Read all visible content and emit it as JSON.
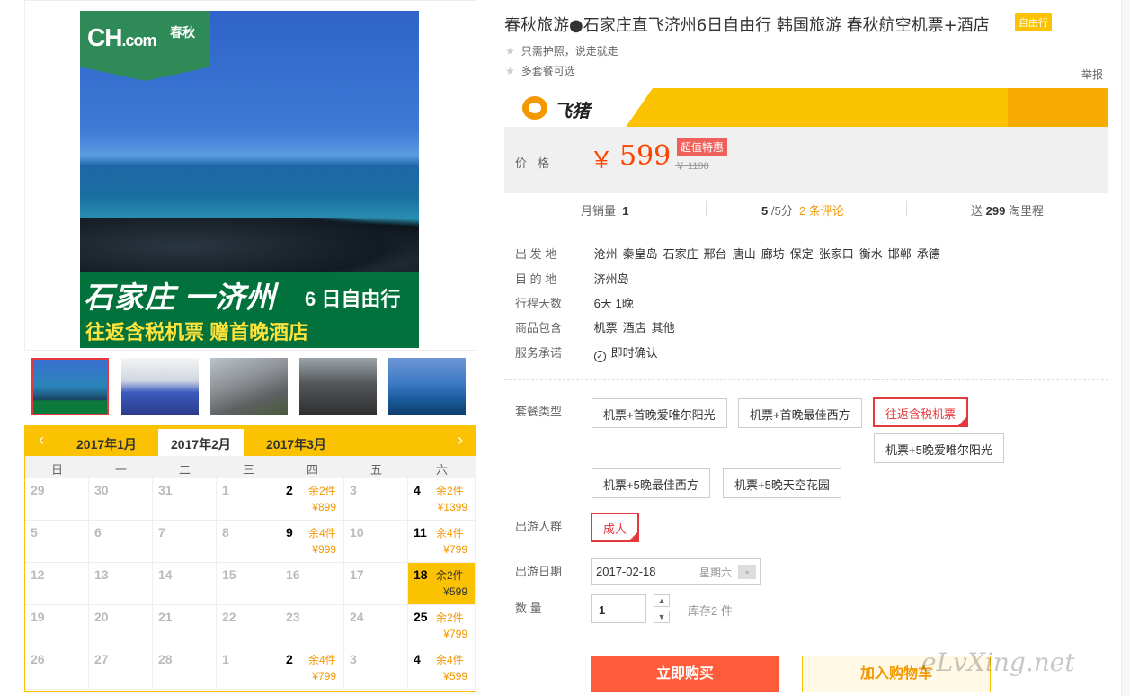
{
  "product": {
    "title": "春秋旅游●石家庄直飞济州6日自由行 韩国旅游 春秋航空机票+酒店",
    "tag": "自由行",
    "features": [
      "只需护照，说走就走",
      "多套餐可选"
    ],
    "report": "举报"
  },
  "image": {
    "logo": "CH",
    "logo_domain": ".com",
    "logo_cn": "春秋",
    "banner_title": "石家庄 一济州",
    "banner_sub1": "6 日自由行",
    "banner_sub2": "往返含税机票  赠首晚酒店"
  },
  "brand": {
    "name": "飞猪",
    "colors": {
      "accent": "#fac200",
      "price": "#ff4400"
    }
  },
  "price": {
    "label": "价格",
    "currency": "￥",
    "value": "599",
    "deal_tag": "超值特惠",
    "original": "￥ 1198"
  },
  "stats": {
    "monthly_sales_label": "月销量",
    "monthly_sales": "1",
    "rating": "5",
    "rating_suffix": "/5分",
    "reviews": "2 条评论",
    "miles_prefix": "送",
    "miles": "299",
    "miles_suffix": "淘里程"
  },
  "info": {
    "departure_label": "出 发 地",
    "departures": [
      "沧州",
      "秦皇岛",
      "石家庄",
      "邢台",
      "唐山",
      "廊坊",
      "保定",
      "张家口",
      "衡水",
      "邯郸",
      "承德"
    ],
    "destination_label": "目 的 地",
    "destination": "济州岛",
    "days_label": "行程天数",
    "days": "6天 1晚",
    "includes_label": "商品包含",
    "includes": [
      "机票",
      "酒店",
      "其他"
    ],
    "promise_label": "服务承诺",
    "promise": "即时确认"
  },
  "packages": {
    "label": "套餐类型",
    "options": [
      "机票+首晚爱唯尔阳光",
      "机票+首晚最佳西方",
      "往返含税机票",
      "机票+5晚爱唯尔阳光",
      "机票+5晚最佳西方",
      "机票+5晚天空花园"
    ],
    "selected": "往返含税机票"
  },
  "travelers": {
    "label": "出游人群",
    "option": "成人"
  },
  "date": {
    "label": "出游日期",
    "value": "2017-02-18",
    "weekday": "星期六"
  },
  "quantity": {
    "label": "数 量",
    "value": "1",
    "stock": "库存2 件"
  },
  "actions": {
    "buy": "立即购买",
    "cart": "加入购物车"
  },
  "watermark": "eLvXing.net",
  "calendar": {
    "months": [
      "2017年1月",
      "2017年2月",
      "2017年3月"
    ],
    "active_month": "2017年2月",
    "weekdays": [
      "日",
      "一",
      "二",
      "三",
      "四",
      "五",
      "六"
    ],
    "weeks": [
      [
        {
          "d": "29"
        },
        {
          "d": "30"
        },
        {
          "d": "31"
        },
        {
          "d": "1"
        },
        {
          "d": "2",
          "s": "余2件",
          "p": "¥899"
        },
        {
          "d": "3"
        },
        {
          "d": "4",
          "s": "余2件",
          "p": "¥1399"
        }
      ],
      [
        {
          "d": "5"
        },
        {
          "d": "6"
        },
        {
          "d": "7"
        },
        {
          "d": "8"
        },
        {
          "d": "9",
          "s": "余4件",
          "p": "¥999"
        },
        {
          "d": "10"
        },
        {
          "d": "11",
          "s": "余4件",
          "p": "¥799"
        }
      ],
      [
        {
          "d": "12"
        },
        {
          "d": "13"
        },
        {
          "d": "14"
        },
        {
          "d": "15"
        },
        {
          "d": "16"
        },
        {
          "d": "17"
        },
        {
          "d": "18",
          "s": "余2件",
          "p": "¥599",
          "sel": true
        }
      ],
      [
        {
          "d": "19"
        },
        {
          "d": "20"
        },
        {
          "d": "21"
        },
        {
          "d": "22"
        },
        {
          "d": "23"
        },
        {
          "d": "24"
        },
        {
          "d": "25",
          "s": "余2件",
          "p": "¥799"
        }
      ],
      [
        {
          "d": "26"
        },
        {
          "d": "27"
        },
        {
          "d": "28"
        },
        {
          "d": "1"
        },
        {
          "d": "2",
          "s": "余4件",
          "p": "¥799"
        },
        {
          "d": "3"
        },
        {
          "d": "4",
          "s": "余4件",
          "p": "¥599"
        }
      ]
    ]
  }
}
